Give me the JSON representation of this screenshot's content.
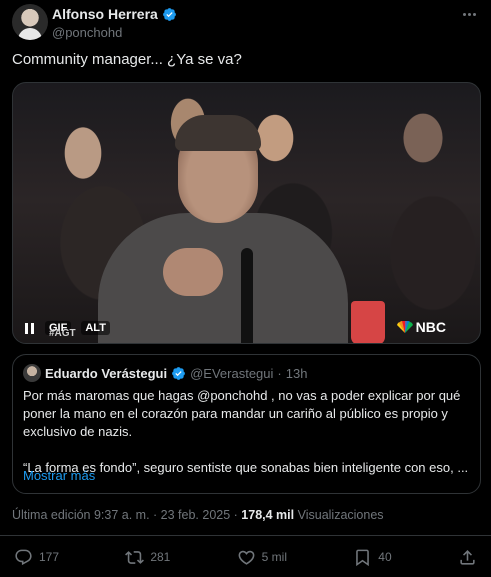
{
  "author": {
    "name": "Alfonso Herrera",
    "handle": "@ponchohd"
  },
  "tweet": {
    "text": "Community manager... ¿Ya se va?"
  },
  "media": {
    "gif_label": "GIF",
    "alt_label": "ALT",
    "overlay_tag": "#AGT",
    "network_logo": "NBC"
  },
  "quote": {
    "name": "Eduardo Verástegui",
    "handle": "@EVerastegui",
    "separator": "·",
    "time": "13h",
    "paragraph1": "Por más maromas que hagas @ponchohd , no vas a poder explicar por qué poner la mano en el corazón para mandar un cariño al público es propio y exclusivo de nazis.",
    "paragraph2": "“La forma es fondo”, seguro sentiste que sonabas bien inteligente con eso, ...",
    "show_more": "Mostrar más"
  },
  "meta": {
    "edited": "Última edición 9:37 a. m. · 23 feb. 2025 · ",
    "views_count": "178,4 mil",
    "views_label": " Visualizaciones"
  },
  "actions": {
    "replies": "177",
    "reposts": "281",
    "likes": "5 mil",
    "bookmarks": "40"
  },
  "colors": {
    "background": "#000000",
    "text": "#e7e9ea",
    "secondary": "#71767b",
    "accent": "#1d9bf0",
    "border": "#2f3336"
  }
}
